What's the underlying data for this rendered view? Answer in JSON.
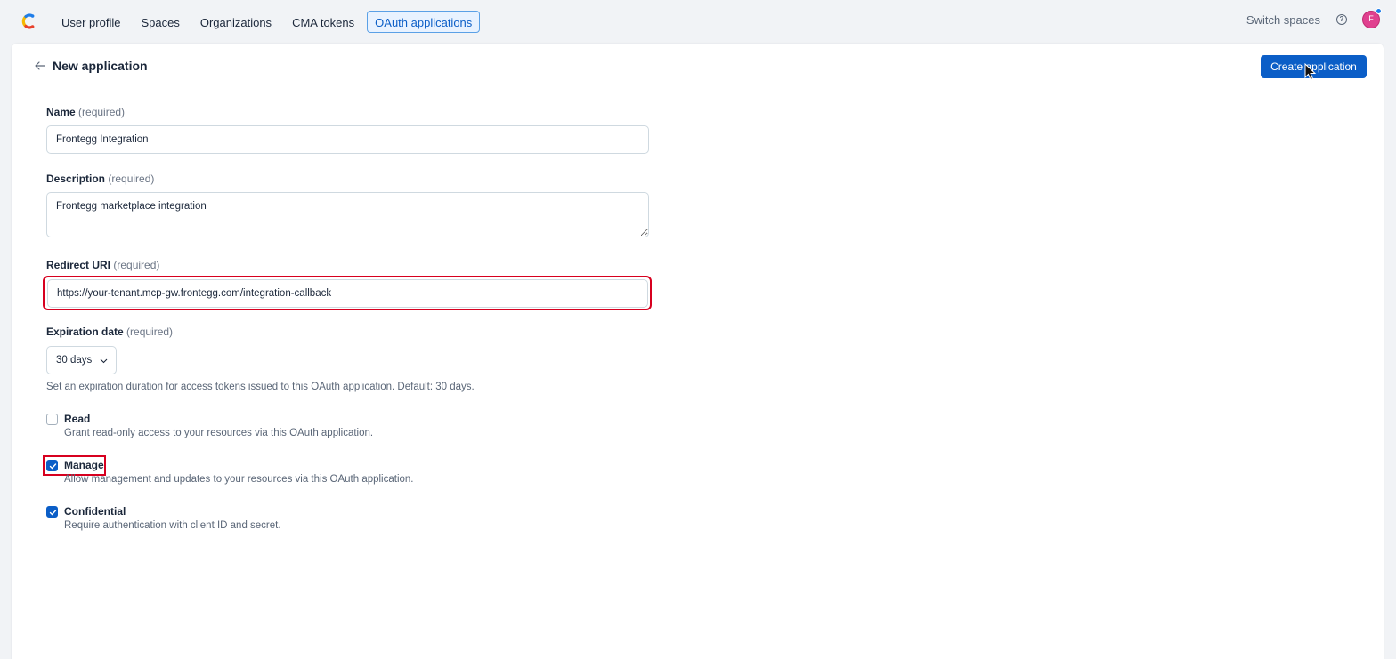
{
  "nav": {
    "items": [
      {
        "label": "User profile",
        "active": false
      },
      {
        "label": "Spaces",
        "active": false
      },
      {
        "label": "Organizations",
        "active": false
      },
      {
        "label": "CMA tokens",
        "active": false
      },
      {
        "label": "OAuth applications",
        "active": true
      }
    ],
    "switch_spaces": "Switch spaces",
    "help_icon": "question-icon",
    "avatar_initial": "F"
  },
  "header": {
    "title": "New application",
    "create_button": "Create application"
  },
  "form": {
    "name": {
      "label": "Name",
      "required": "(required)",
      "value": "Frontegg Integration"
    },
    "description": {
      "label": "Description",
      "required": "(required)",
      "value": "Frontegg marketplace integration"
    },
    "redirect_uri": {
      "label": "Redirect URI",
      "required": "(required)",
      "value": "https://your-tenant.mcp-gw.frontegg.com/integration-callback"
    },
    "expiration": {
      "label": "Expiration date",
      "required": "(required)",
      "selected": "30 days",
      "help": "Set an expiration duration for access tokens issued to this OAuth application. Default: 30 days."
    },
    "scopes": [
      {
        "label": "Read",
        "description": "Grant read-only access to your resources via this OAuth application.",
        "checked": false
      },
      {
        "label": "Manage",
        "description": "Allow management and updates to your resources via this OAuth application.",
        "checked": true
      },
      {
        "label": "Confidential",
        "description": "Require authentication with client ID and secret.",
        "checked": true
      }
    ]
  },
  "colors": {
    "primary": "#0b5ec7",
    "highlight": "#d7001f",
    "avatar": "#e0408f"
  }
}
